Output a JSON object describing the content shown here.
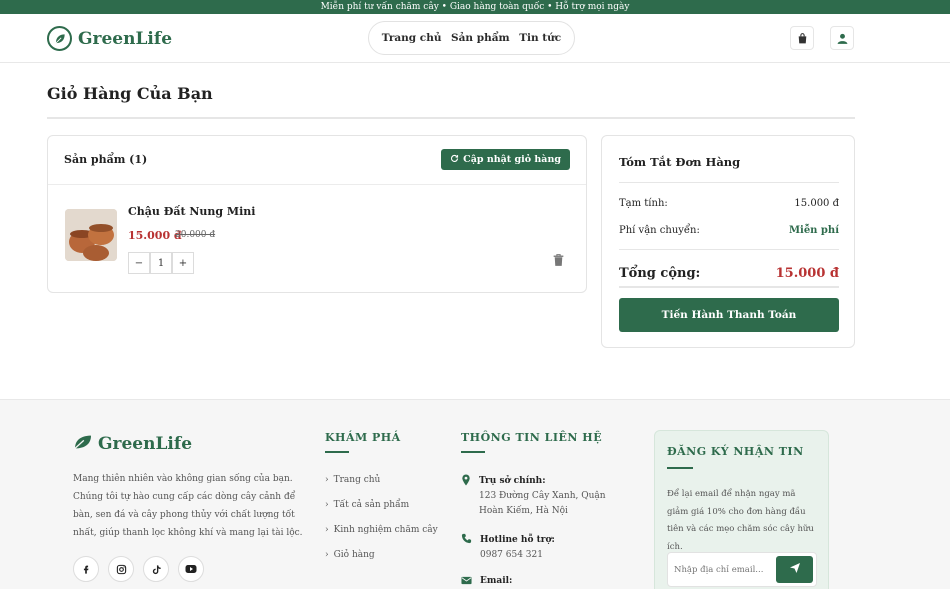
{
  "topbar": {
    "text": "Miễn phí tư vấn chăm cây • Giao hàng toàn quốc • Hỗ trợ mọi ngày"
  },
  "brand": {
    "name": "GreenLife",
    "color": "#2e6b4c",
    "accent_red": "#b83232"
  },
  "nav": {
    "items": [
      "Trang chủ",
      "Sản phẩm",
      "Tin tức"
    ]
  },
  "header_icons": [
    "shopping-bag-icon",
    "user-icon"
  ],
  "page": {
    "title": "Giỏ Hàng Của Bạn"
  },
  "cart": {
    "heading": "Sản phẩm (1)",
    "update_label": "Cập nhật giỏ hàng",
    "items": [
      {
        "name": "Chậu Đất Nung Mini",
        "price": "15.000 đ",
        "old_price": "20.000 đ",
        "quantity": "1"
      }
    ]
  },
  "summary": {
    "title": "Tóm Tắt Đơn Hàng",
    "subtotal_label": "Tạm tính:",
    "subtotal_value": "15.000 đ",
    "shipping_label": "Phí vận chuyển:",
    "shipping_value": "Miễn phí",
    "total_label": "Tổng cộng:",
    "total_value": "15.000 đ",
    "checkout_label": "Tiến Hành Thanh Toán"
  },
  "footer": {
    "brand": "GreenLife",
    "description": "Mang thiên nhiên vào không gian sống của bạn. Chúng tôi tự hào cung cấp các dòng cây cảnh để bàn, sen đá và cây phong thủy với chất lượng tốt nhất, giúp thanh lọc không khí và mang lại tài lộc.",
    "socials": [
      "facebook-icon",
      "instagram-icon",
      "tiktok-icon",
      "youtube-icon"
    ],
    "explore": {
      "title": "KHÁM PHÁ",
      "links": [
        "Trang chủ",
        "Tất cả sản phẩm",
        "Kinh nghiệm chăm cây",
        "Giỏ hàng"
      ]
    },
    "contact": {
      "title": "THÔNG TIN LIÊN HỆ",
      "address_label": "Trụ sở chính:",
      "address": "123 Đường Cây Xanh, Quận Hoàn Kiếm, Hà Nội",
      "hotline_label": "Hotline hỗ trợ:",
      "hotline": "0987 654 321",
      "email_label": "Email:"
    },
    "newsletter": {
      "title": "ĐĂNG KÝ NHẬN TIN",
      "description": "Để lại email để nhận ngay mã giảm giá 10% cho đơn hàng đầu tiên và các mẹo chăm sóc cây hữu ích.",
      "placeholder": "Nhập địa chỉ email..."
    }
  }
}
